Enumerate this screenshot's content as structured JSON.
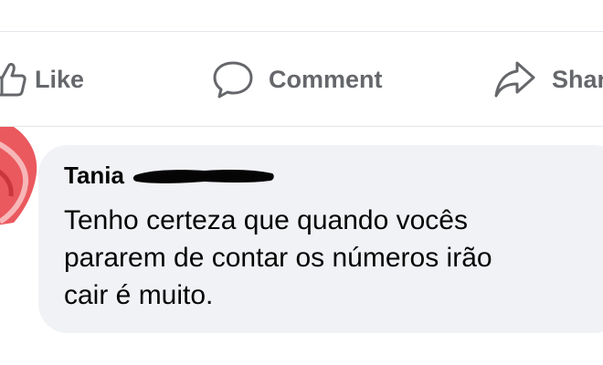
{
  "actions": {
    "like_label": "Like",
    "comment_label": "Comment",
    "share_label": "Shar"
  },
  "comment": {
    "author": "Tania",
    "text": "Tenho certeza que quando vocês\npararem de contar os números irão\ncair é muito."
  },
  "colors": {
    "action_text": "#65676b",
    "bubble_bg": "#f0f2f5",
    "divider": "#e4e6eb",
    "avatar_accent": "#e8474d"
  }
}
